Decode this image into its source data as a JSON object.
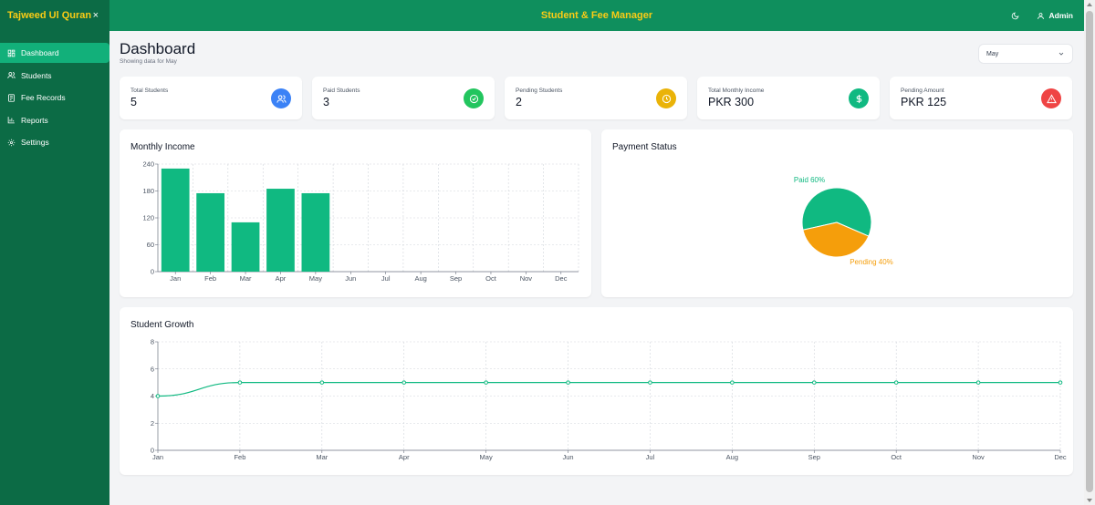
{
  "sidebar": {
    "brand": "Tajweed Ul Quran",
    "close": "×",
    "items": [
      {
        "label": "Dashboard",
        "icon": "dashboard-icon",
        "active": true
      },
      {
        "label": "Students",
        "icon": "users-icon"
      },
      {
        "label": "Fee Records",
        "icon": "receipt-icon"
      },
      {
        "label": "Reports",
        "icon": "bar-chart-icon"
      },
      {
        "label": "Settings",
        "icon": "gear-icon"
      }
    ]
  },
  "header": {
    "title": "Student & Fee Manager",
    "user": "Admin"
  },
  "page": {
    "title": "Dashboard",
    "subtitle": "Showing data for May",
    "month_select": "May"
  },
  "stats": [
    {
      "label": "Total Students",
      "value": "5",
      "color": "#3b82f6",
      "icon": "users-icon"
    },
    {
      "label": "Paid Students",
      "value": "3",
      "color": "#22c55e",
      "icon": "check-circle-icon"
    },
    {
      "label": "Pending Students",
      "value": "2",
      "color": "#eab308",
      "icon": "clock-icon"
    },
    {
      "label": "Total Monthly Income",
      "value": "PKR 300",
      "color": "#10b981",
      "icon": "dollar-icon"
    },
    {
      "label": "Pending Amount",
      "value": "PKR 125",
      "color": "#ef4444",
      "icon": "alert-triangle-icon"
    }
  ],
  "colors": {
    "brand_green": "#0f8f5d",
    "sidebar_green": "#0c6b45",
    "accent_green": "#10b981",
    "pending_orange": "#f59e0b",
    "title_yellow": "#facc15"
  },
  "panels": {
    "income_title": "Monthly Income",
    "status_title": "Payment Status",
    "growth_title": "Student Growth"
  },
  "chart_data": [
    {
      "type": "bar",
      "title": "Monthly Income",
      "categories": [
        "Jan",
        "Feb",
        "Mar",
        "Apr",
        "May",
        "Jun",
        "Jul",
        "Aug",
        "Sep",
        "Oct",
        "Nov",
        "Dec"
      ],
      "values": [
        230,
        175,
        110,
        185,
        175,
        0,
        0,
        0,
        0,
        0,
        0,
        0
      ],
      "yticks": [
        0,
        60,
        120,
        180,
        240
      ],
      "ylim": [
        0,
        240
      ],
      "grid": true,
      "color": "#10b981"
    },
    {
      "type": "pie",
      "title": "Payment Status",
      "slices": [
        {
          "name": "Paid",
          "value": 60,
          "label": "Paid 60%",
          "color": "#10b981"
        },
        {
          "name": "Pending",
          "value": 40,
          "label": "Pending 40%",
          "color": "#f59e0b"
        }
      ]
    },
    {
      "type": "line",
      "title": "Student Growth",
      "categories": [
        "Jan",
        "Feb",
        "Mar",
        "Apr",
        "May",
        "Jun",
        "Jul",
        "Aug",
        "Sep",
        "Oct",
        "Nov",
        "Dec"
      ],
      "values": [
        4,
        5,
        5,
        5,
        5,
        5,
        5,
        5,
        5,
        5,
        5,
        5
      ],
      "yticks": [
        0,
        2,
        4,
        6,
        8
      ],
      "ylim": [
        0,
        8
      ],
      "grid": true,
      "color": "#10b981"
    }
  ]
}
